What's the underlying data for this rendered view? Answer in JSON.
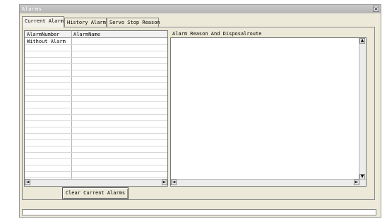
{
  "window": {
    "title": "Alarms",
    "close_label": "×"
  },
  "tabs": [
    {
      "label": "Current Alarm",
      "active": true
    },
    {
      "label": "History Alarm",
      "active": false
    },
    {
      "label": "Servo Stop Reason",
      "active": false
    }
  ],
  "alarm_table": {
    "columns": [
      "AlarmNumber",
      "AlarmName"
    ],
    "rows": [
      [
        "Without Alarm",
        ""
      ]
    ]
  },
  "reason": {
    "label": "Alarm Reason And Disposalroute",
    "text": ""
  },
  "buttons": {
    "clear_label": "Clear Current Alarms"
  },
  "scroll": {
    "left": "◄",
    "right": "►",
    "up": "▲",
    "down": "▼"
  }
}
